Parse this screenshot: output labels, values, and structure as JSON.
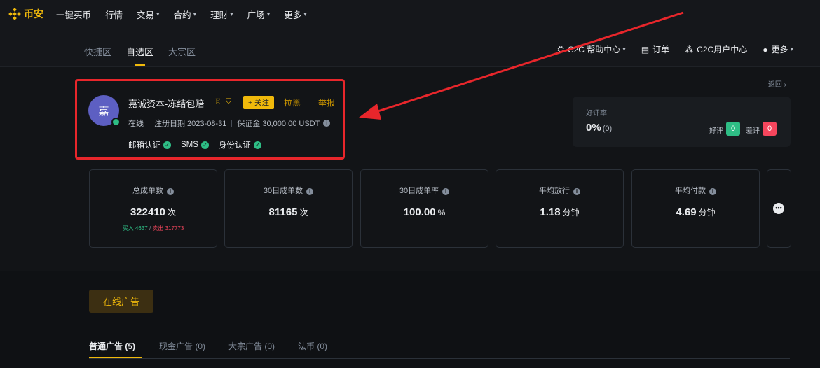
{
  "brand": {
    "name": "币安"
  },
  "top_nav": [
    {
      "label": "一键买币",
      "dropdown": false
    },
    {
      "label": "行情",
      "dropdown": false
    },
    {
      "label": "交易",
      "dropdown": true
    },
    {
      "label": "合约",
      "dropdown": true
    },
    {
      "label": "理财",
      "dropdown": true
    },
    {
      "label": "广场",
      "dropdown": true
    },
    {
      "label": "更多",
      "dropdown": true
    }
  ],
  "sub_tabs": [
    "快捷区",
    "自选区",
    "大宗区"
  ],
  "sub_tab_active": "自选区",
  "right_links": {
    "help": "C2C 帮助中心",
    "orders": "订单",
    "user_center": "C2C用户中心",
    "more": "更多"
  },
  "back_link": "返回",
  "merchant": {
    "avatar_char": "嘉",
    "name": "嘉诚资本-冻结包赔",
    "follow_label": "+ 关注",
    "block_label": "拉黑",
    "report_label": "举报",
    "status": "在线",
    "registered": "注册日期 2023-08-31",
    "deposit": "保证金 30,000.00 USDT",
    "verifications": [
      "邮箱认证",
      "SMS",
      "身份认证"
    ]
  },
  "rating": {
    "label": "好评率",
    "value": "0%",
    "count": "(0)",
    "positive_label": "好评",
    "positive_count": "0",
    "negative_label": "差评",
    "negative_count": "0"
  },
  "stats": [
    {
      "label": "总成单数",
      "value": "322410",
      "unit": "次",
      "buy": "买入 4637",
      "sell": "卖出 317773"
    },
    {
      "label": "30日成单数",
      "value": "81165",
      "unit": "次"
    },
    {
      "label": "30日成单率",
      "value": "100.00",
      "unit": "%"
    },
    {
      "label": "平均放行",
      "value": "1.18",
      "unit": "分钟"
    },
    {
      "label": "平均付款",
      "value": "4.69",
      "unit": "分钟"
    }
  ],
  "ads_section": {
    "button": "在线广告",
    "tabs": [
      {
        "label": "普通广告",
        "count": "(5)"
      },
      {
        "label": "现金广告",
        "count": "(0)"
      },
      {
        "label": "大宗广告",
        "count": "(0)"
      },
      {
        "label": "法币",
        "count": "(0)"
      }
    ]
  },
  "colors": {
    "accent": "#f0b90b",
    "positive": "#2ebd85",
    "negative": "#f6465d",
    "annotation": "#e8262b"
  }
}
